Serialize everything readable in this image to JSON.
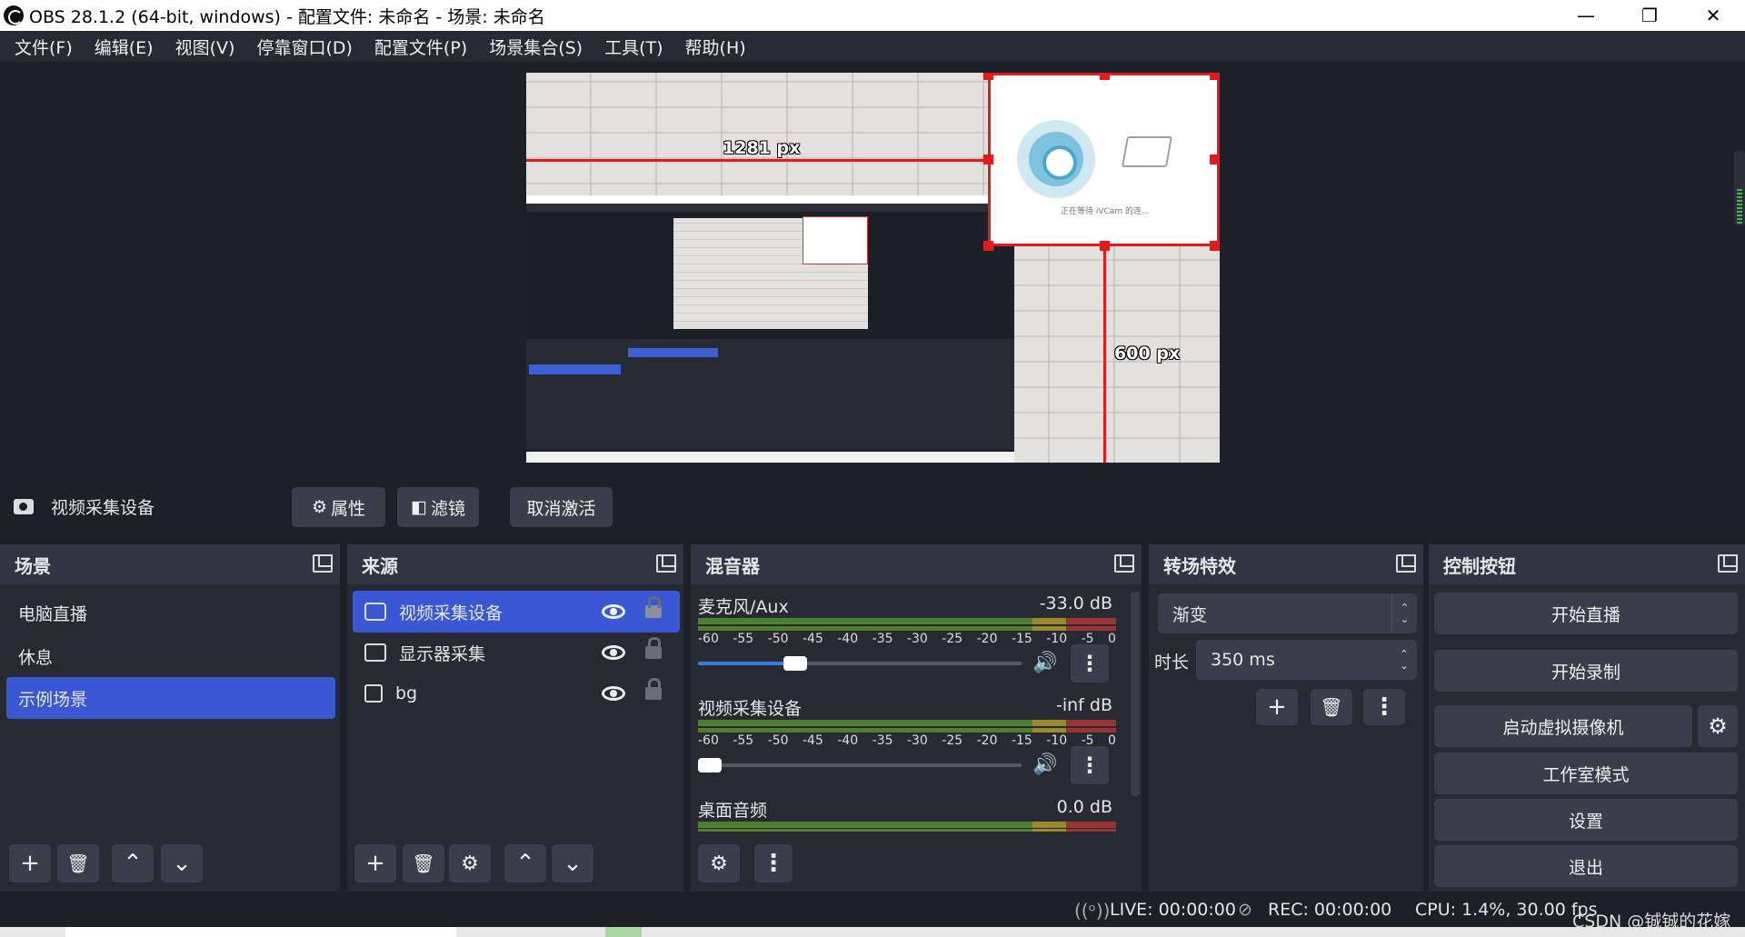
{
  "window": {
    "title": "OBS 28.1.2 (64-bit, windows) - 配置文件: 未命名 - 场景: 未命名",
    "minimize": "—",
    "maximize": "❐",
    "close": "✕"
  },
  "menu": [
    "文件(F)",
    "编辑(E)",
    "视图(V)",
    "停靠窗口(D)",
    "配置文件(P)",
    "场景集合(S)",
    "工具(T)",
    "帮助(H)"
  ],
  "preview": {
    "width_label": "1281 px",
    "height_label": "600 px",
    "cam_caption": "正在等待 iVCam 的连..."
  },
  "source_toolbar": {
    "source_name": "视频采集设备",
    "properties": "属性",
    "filters": "滤镜",
    "deactivate": "取消激活"
  },
  "scenes": {
    "title": "场景",
    "items": [
      "电脑直播",
      "休息",
      "示例场景"
    ],
    "selected": "示例场景"
  },
  "sources": {
    "title": "来源",
    "items": [
      {
        "label": "视频采集设备",
        "icon": "camera-icon"
      },
      {
        "label": "显示器采集",
        "icon": "monitor-icon"
      },
      {
        "label": "bg",
        "icon": "image-icon"
      }
    ],
    "selected": "视频采集设备"
  },
  "mixer": {
    "title": "混音器",
    "scale": [
      "-60",
      "-55",
      "-50",
      "-45",
      "-40",
      "-35",
      "-30",
      "-25",
      "-20",
      "-15",
      "-10",
      "-5",
      "0"
    ],
    "channels": [
      {
        "name": "麦克风/Aux",
        "db": "-33.0 dB",
        "volume": 0.3
      },
      {
        "name": "视频采集设备",
        "db": "-inf dB",
        "volume": 0.0
      },
      {
        "name": "桌面音频",
        "db": "0.0 dB",
        "volume": 1.0
      }
    ]
  },
  "transitions": {
    "title": "转场特效",
    "selected": "渐变",
    "duration_label": "时长",
    "duration_value": "350 ms"
  },
  "controls": {
    "title": "控制按钮",
    "start_stream": "开始直播",
    "start_record": "开始录制",
    "virtual_cam": "启动虚拟摄像机",
    "studio_mode": "工作室模式",
    "settings": "设置",
    "exit": "退出"
  },
  "status": {
    "live": "LIVE: 00:00:00",
    "rec": "REC: 00:00:00",
    "cpu": "CPU: 1.4%, 30.00 fps"
  },
  "watermark": "CSDN @铖铖的花嫁",
  "colors": {
    "accent": "#3a58d4",
    "selection_outline": "#e31b1b",
    "background": "#1e2029"
  }
}
